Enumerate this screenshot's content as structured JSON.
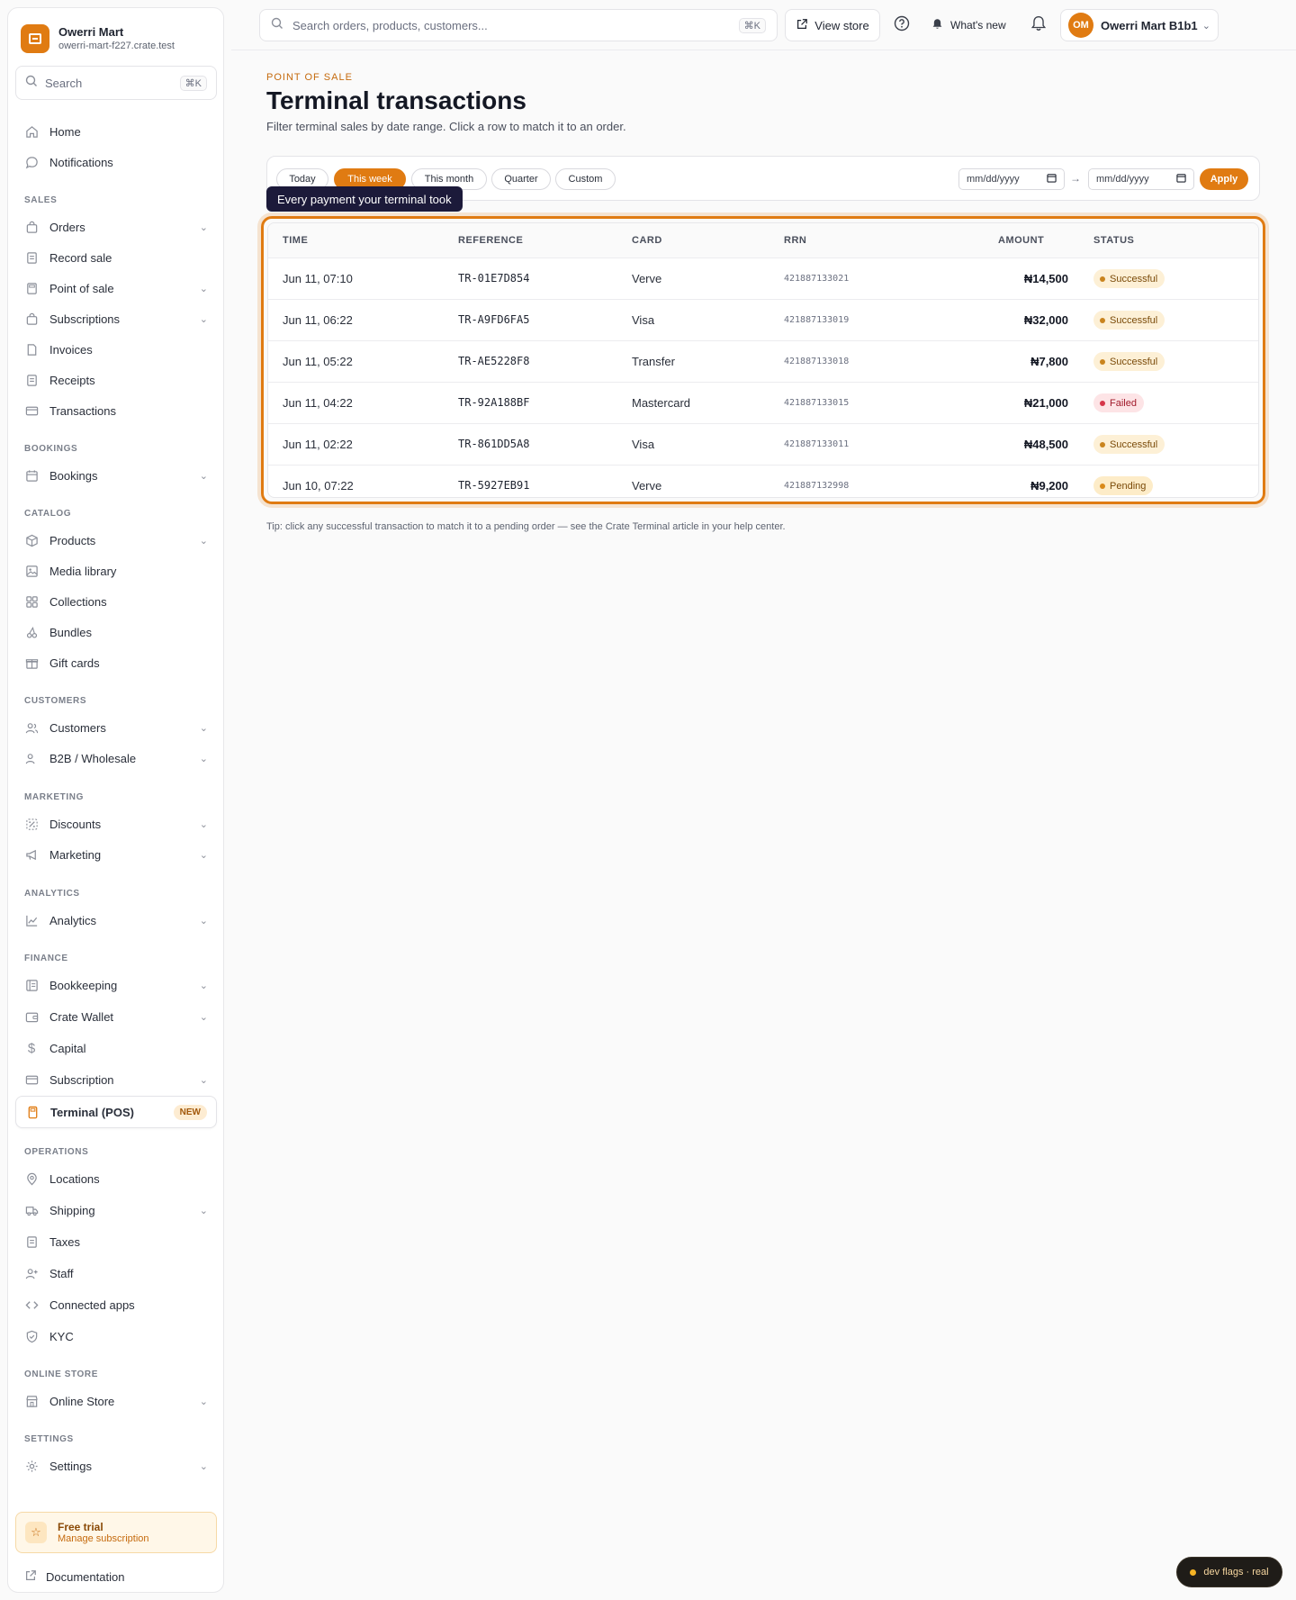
{
  "brand": {
    "name": "Owerri Mart",
    "url": "owerri-mart-f227.crate.test",
    "logo_icon": "store-icon"
  },
  "sidebar": {
    "search_label": "Search",
    "search_shortcut": "⌘K",
    "top_items": [
      {
        "label": "Home",
        "icon": "home-icon"
      },
      {
        "label": "Notifications",
        "icon": "chat-bubble-icon"
      }
    ],
    "sections": {
      "sales": "SALES",
      "bookings": "BOOKINGS",
      "catalog": "CATALOG",
      "customers": "CUSTOMERS",
      "marketing": "MARKETING",
      "analytics": "ANALYTICS",
      "finance": "FINANCE",
      "operations": "OPERATIONS",
      "online_store": "ONLINE STORE",
      "settings": "SETTINGS"
    },
    "items": {
      "orders": "Orders",
      "record_sale": "Record sale",
      "point_of_sale": "Point of sale",
      "subscriptions": "Subscriptions",
      "invoices": "Invoices",
      "receipts": "Receipts",
      "transactions": "Transactions",
      "bookings": "Bookings",
      "products": "Products",
      "media_library": "Media library",
      "collections": "Collections",
      "bundles": "Bundles",
      "gift_cards": "Gift cards",
      "customers": "Customers",
      "b2b": "B2B / Wholesale",
      "discounts": "Discounts",
      "marketing": "Marketing",
      "analytics": "Analytics",
      "bookkeeping": "Bookkeeping",
      "crate_wallet": "Crate Wallet",
      "capital": "Capital",
      "subscription": "Subscription",
      "terminal": "Terminal (POS)",
      "terminal_badge": "NEW",
      "locations": "Locations",
      "shipping": "Shipping",
      "taxes": "Taxes",
      "staff": "Staff",
      "connected_apps": "Connected apps",
      "kyc": "KYC",
      "online_store": "Online Store",
      "settings": "Settings"
    },
    "trial": {
      "title": "Free trial",
      "subtitle": "Manage subscription"
    },
    "documentation": "Documentation"
  },
  "topbar": {
    "search_placeholder": "Search orders, products, customers...",
    "search_shortcut": "⌘K",
    "view_store": "View store",
    "whats_new": "What's new",
    "avatar_initials": "OM",
    "account_name": "Owerri Mart B1b1"
  },
  "page": {
    "eyebrow": "POINT OF SALE",
    "title": "Terminal transactions",
    "subtitle": "Filter terminal sales by date range. Click a row to match it to an order."
  },
  "filters": {
    "chips": [
      "Today",
      "This week",
      "This month",
      "Quarter",
      "Custom"
    ],
    "active_chip": "This week",
    "date_from_placeholder": "mm/dd/yyyy",
    "date_to_placeholder": "mm/dd/yyyy",
    "apply": "Apply"
  },
  "tooltip": "Every payment your terminal took",
  "table": {
    "columns": [
      "TIME",
      "REFERENCE",
      "CARD",
      "RRN",
      "AMOUNT",
      "STATUS"
    ],
    "rows": [
      {
        "time": "Jun 11, 07:10",
        "reference": "TR-01E7D854",
        "card": "Verve",
        "rrn": "421887133021",
        "amount": "₦14,500",
        "status": "Successful"
      },
      {
        "time": "Jun 11, 06:22",
        "reference": "TR-A9FD6FA5",
        "card": "Visa",
        "rrn": "421887133019",
        "amount": "₦32,000",
        "status": "Successful"
      },
      {
        "time": "Jun 11, 05:22",
        "reference": "TR-AE5228F8",
        "card": "Transfer",
        "rrn": "421887133018",
        "amount": "₦7,800",
        "status": "Successful"
      },
      {
        "time": "Jun 11, 04:22",
        "reference": "TR-92A188BF",
        "card": "Mastercard",
        "rrn": "421887133015",
        "amount": "₦21,000",
        "status": "Failed"
      },
      {
        "time": "Jun 11, 02:22",
        "reference": "TR-861DD5A8",
        "card": "Visa",
        "rrn": "421887133011",
        "amount": "₦48,500",
        "status": "Successful"
      },
      {
        "time": "Jun 10, 07:22",
        "reference": "TR-5927EB91",
        "card": "Verve",
        "rrn": "421887132998",
        "amount": "₦9,200",
        "status": "Pending"
      }
    ]
  },
  "tip": "Tip: click any successful transaction to match it to a pending order — see the Crate Terminal article in your help center.",
  "dev_flags": "dev flags · real",
  "colors": {
    "accent": "#e07b12",
    "tooltip_bg": "#1c1a3a",
    "failed": "#d6364a",
    "text": "#1f2430"
  }
}
